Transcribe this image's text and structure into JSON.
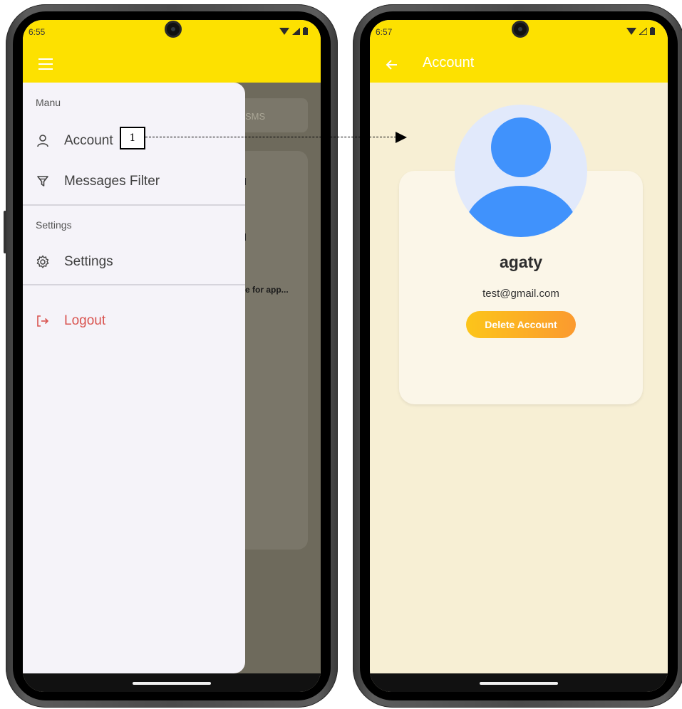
{
  "left_screen": {
    "status_time": "6:55",
    "drawer": {
      "section_menu": "Manu",
      "items_top": [
        {
          "label": "Account",
          "icon": "person-icon"
        },
        {
          "label": "Messages Filter",
          "icon": "filter-icon"
        }
      ],
      "section_settings": "Settings",
      "settings_item": {
        "label": "Settings",
        "icon": "gear-icon"
      },
      "logout": {
        "label": "Logout",
        "icon": "logout-icon",
        "color": "#d9534f"
      }
    },
    "background": {
      "chip_text": "SMS",
      "card_text": "e for app..."
    }
  },
  "right_screen": {
    "status_time": "6:57",
    "app_title": "Account",
    "profile": {
      "name": "agaty",
      "email": "test@gmail.com",
      "delete_button": "Delete Account"
    }
  },
  "annotation": {
    "step": "1"
  },
  "colors": {
    "app_bar": "#fde100",
    "drawer_bg": "#f5f3f9",
    "page_bg": "#f7efd4",
    "avatar_blue": "#4092fc",
    "button_gradient_start": "#fcc51a",
    "button_gradient_end": "#fb9a2f"
  }
}
